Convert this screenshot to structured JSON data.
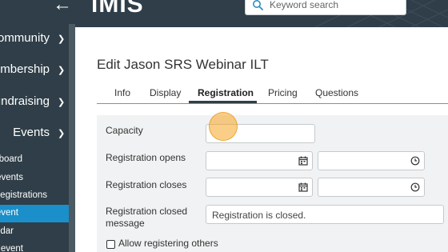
{
  "sidebar": {
    "items": [
      {
        "label": "Community"
      },
      {
        "label": "Membership"
      },
      {
        "label": "Fundraising"
      },
      {
        "label": "Events"
      }
    ],
    "sub_items": [
      {
        "label": "Dashboard"
      },
      {
        "label": "Find events"
      },
      {
        "label": "Find registrations"
      },
      {
        "label": "New event"
      },
      {
        "label": "Calendar"
      },
      {
        "label": "Copy event"
      }
    ]
  },
  "header": {
    "logo": "iMIS",
    "search": {
      "placeholder": "Keyword search"
    }
  },
  "main": {
    "title": "Edit Jason SRS Webinar ILT",
    "tabs": [
      {
        "label": "Info"
      },
      {
        "label": "Display"
      },
      {
        "label": "Registration"
      },
      {
        "label": "Pricing"
      },
      {
        "label": "Questions"
      }
    ],
    "active_tab": "Registration",
    "form": {
      "capacity_label": "Capacity",
      "capacity_value": "",
      "opens_label": "Registration opens",
      "closes_label": "Registration closes",
      "closed_message_label": "Registration closed message",
      "closed_message_value": "Registration is closed.",
      "allow_others_label": "Allow registering others",
      "allow_others_checked": false
    }
  },
  "colors": {
    "sidebar_bg": "#2f3e48",
    "active_item": "#1a8fc9",
    "click_indicator": "#f5a623"
  },
  "icons": [
    "back-arrow-icon",
    "chevron-down-icon",
    "search-icon",
    "calendar-icon",
    "clock-icon"
  ]
}
